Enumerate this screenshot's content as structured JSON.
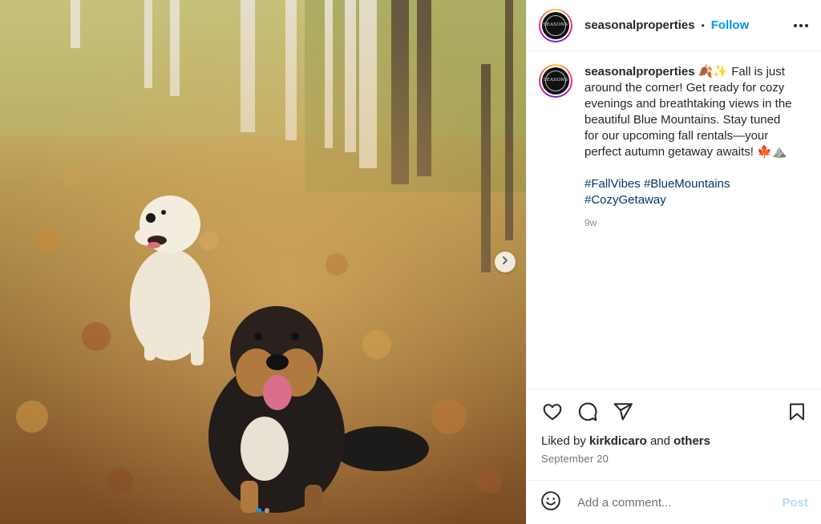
{
  "post": {
    "username": "seasonalproperties",
    "separator": "•",
    "follow_label": "Follow",
    "avatar_text": "SEASONS",
    "caption": {
      "username": "seasonalproperties",
      "text": "🍂✨ Fall is just around the corner! Get ready for cozy evenings and breathtaking views in the beautiful Blue Mountains. Stay tuned for our upcoming fall rentals—your perfect autumn getaway awaits! 🍁⛰️",
      "hashtags": [
        "#FallVibes",
        "#BlueMountains",
        "#CozyGetaway"
      ],
      "time_ago": "9w"
    },
    "likes": {
      "prefix": "Liked by",
      "user": "kirkdicaro",
      "conjunction": "and",
      "others": "others"
    },
    "date": "September 20",
    "comment": {
      "placeholder": "Add a comment...",
      "post_label": "Post"
    },
    "carousel": {
      "slide_count": 2,
      "active_index": 0
    }
  },
  "icons": {
    "more": "more-options-icon",
    "like": "heart-icon",
    "comment": "comment-icon",
    "share": "share-icon",
    "save": "bookmark-icon",
    "emoji": "emoji-icon",
    "next": "chevron-right-icon"
  },
  "colors": {
    "link": "#0095f6",
    "hashtag": "#00376b",
    "muted": "#8e8e8e",
    "post_disabled": "#b2dffc"
  }
}
